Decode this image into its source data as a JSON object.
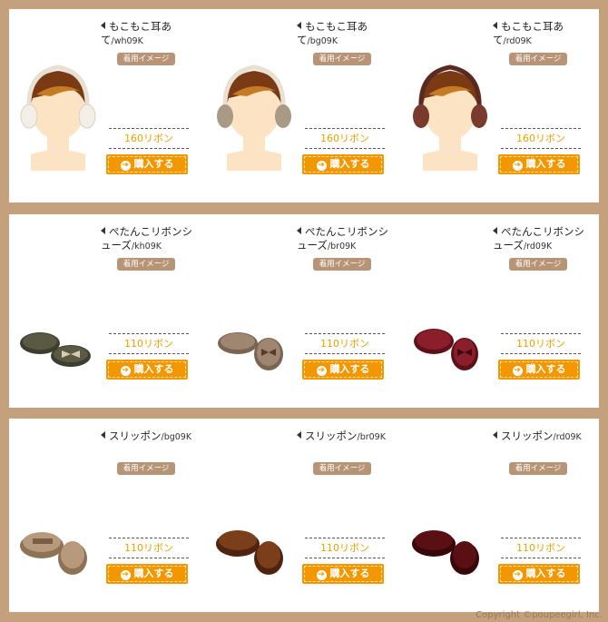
{
  "products": [
    {
      "category": "earmuffs",
      "price": "160リボン",
      "items": [
        {
          "name": "もこもこ耳あて",
          "code": "/wh09K",
          "image_label": "着用イメージ",
          "buy_label": "購入する",
          "color": "#f4efe6"
        },
        {
          "name": "もこもこ耳あて",
          "code": "/bg09K",
          "image_label": "着用イメージ",
          "buy_label": "購入する",
          "color": "#a89a86"
        },
        {
          "name": "もこもこ耳あて",
          "code": "/rd09K",
          "image_label": "着用イメージ",
          "buy_label": "購入する",
          "color": "#7a3a2e"
        }
      ]
    },
    {
      "category": "flat-shoes",
      "price": "110リボン",
      "items": [
        {
          "name": "ぺたんこリボンシューズ",
          "code": "/kh09K",
          "image_label": "着用イメージ",
          "buy_label": "購入する",
          "color": "#5a5a44"
        },
        {
          "name": "ぺたんこリボンシューズ",
          "code": "/br09K",
          "image_label": "着用イメージ",
          "buy_label": "購入する",
          "color": "#9e8670"
        },
        {
          "name": "ぺたんこリボンシューズ",
          "code": "/rd09K",
          "image_label": "着用イメージ",
          "buy_label": "購入する",
          "color": "#8a1e2a"
        }
      ]
    },
    {
      "category": "slip-on",
      "price": "110リボン",
      "items": [
        {
          "name": "スリッポン",
          "code": "/bg09K",
          "image_label": "着用イメージ",
          "buy_label": "購入する",
          "color": "#b79a7c"
        },
        {
          "name": "スリッポン",
          "code": "/br09K",
          "image_label": "着用イメージ",
          "buy_label": "購入する",
          "color": "#7a3f1a"
        },
        {
          "name": "スリッポン",
          "code": "/rd09K",
          "image_label": "着用イメージ",
          "buy_label": "購入する",
          "color": "#5a0f14"
        }
      ]
    }
  ],
  "footer": {
    "copyright": "Copyright ©poupeegirl, Inc."
  },
  "icons": {
    "arrow": "left-triangle-icon",
    "buy": "arrow-circle-icon"
  }
}
